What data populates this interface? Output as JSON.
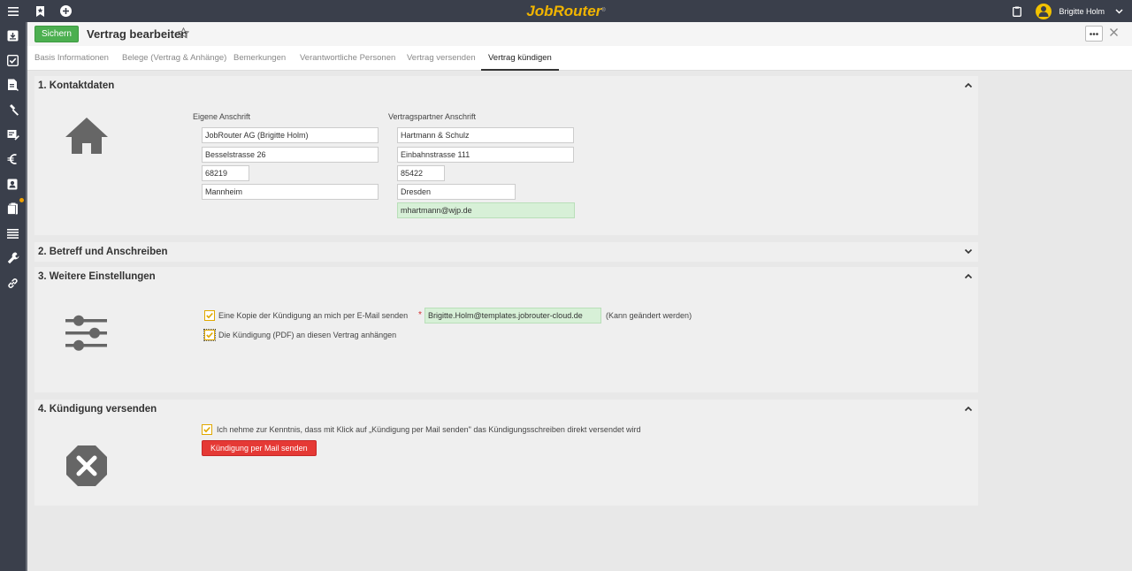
{
  "topbar": {
    "brand": "JobRouter",
    "brand_mark": "®",
    "user_name": "Brigitte Holm",
    "icons": [
      "menu-icon",
      "bookmark-icon",
      "add-circle-icon",
      "clipboard-icon",
      "chevron-down-icon"
    ]
  },
  "sidebar": {
    "icons": [
      "inbox-icon",
      "checked-box-icon",
      "document-icon",
      "hammer-icon",
      "form-edit-icon",
      "euro-icon",
      "contact-card-icon",
      "clipboard-icon",
      "list-icon",
      "wrench-icon",
      "link-icon"
    ]
  },
  "header": {
    "save_label": "Sichern",
    "title": "Vertrag bearbeiten",
    "more_label": "···"
  },
  "tabs": [
    {
      "label": "Basis Informationen"
    },
    {
      "label": "Belege (Vertrag & Anhänge)"
    },
    {
      "label": "Bemerkungen"
    },
    {
      "label": "Verantwortliche Personen"
    },
    {
      "label": "Vertrag versenden"
    },
    {
      "label": "Vertrag kündigen"
    }
  ],
  "kontakt": {
    "title": "1. Kontaktdaten",
    "own_label": "Eigene Anschrift",
    "partner_label": "Vertragspartner Anschrift",
    "own": {
      "name": "JobRouter AG (Brigitte Holm)",
      "street": "Besselstrasse 26",
      "zip": "68219",
      "city": "Mannheim"
    },
    "partner": {
      "name": "Hartmann & Schulz",
      "street": "Einbahnstrasse 111",
      "zip": "85422",
      "city": "Dresden",
      "email": "mhartmann@wjp.de"
    }
  },
  "betreff": {
    "title": "2. Betreff und Anschreiben"
  },
  "einstellungen": {
    "title": "3. Weitere Einstellungen",
    "copy_label": "Eine Kopie der Kündigung an mich per E-Mail senden",
    "required_mark": "*",
    "copy_email": "Brigitte.Holm@templates.jobrouter-cloud.de",
    "copy_hint": "(Kann geändert werden)",
    "attach_label": "Die Kündigung (PDF) an diesen Vertrag anhängen"
  },
  "versenden": {
    "title": "4. Kündigung versenden",
    "confirm_label": "Ich nehme zur Kenntnis, dass mit Klick auf „Kündigung per Mail senden\" das Kündigungsschreiben direkt versendet wird",
    "send_label": "Kündigung per Mail senden"
  },
  "colors": {
    "topbar": "#3a3f4b",
    "brand": "#f0b400",
    "save_button": "#4caf50",
    "send_button": "#e53935",
    "checkbox_border": "#e0a800",
    "email_field": "#d7f0d7"
  }
}
